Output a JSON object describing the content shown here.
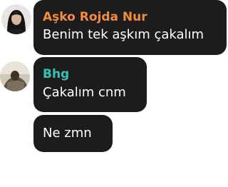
{
  "messages": [
    {
      "sender": "Aşko Rojda Nur",
      "sender_color": "#f28c3a",
      "text": "Benim tek aşkım çakalım",
      "avatar_icon": "profile-photo-avatar"
    },
    {
      "sender": "Bhg",
      "sender_color": "#3ac1b4",
      "text": "Çakalım cnm",
      "avatar_icon": "profile-photo-avatar"
    },
    {
      "text": "Ne zmn"
    }
  ]
}
